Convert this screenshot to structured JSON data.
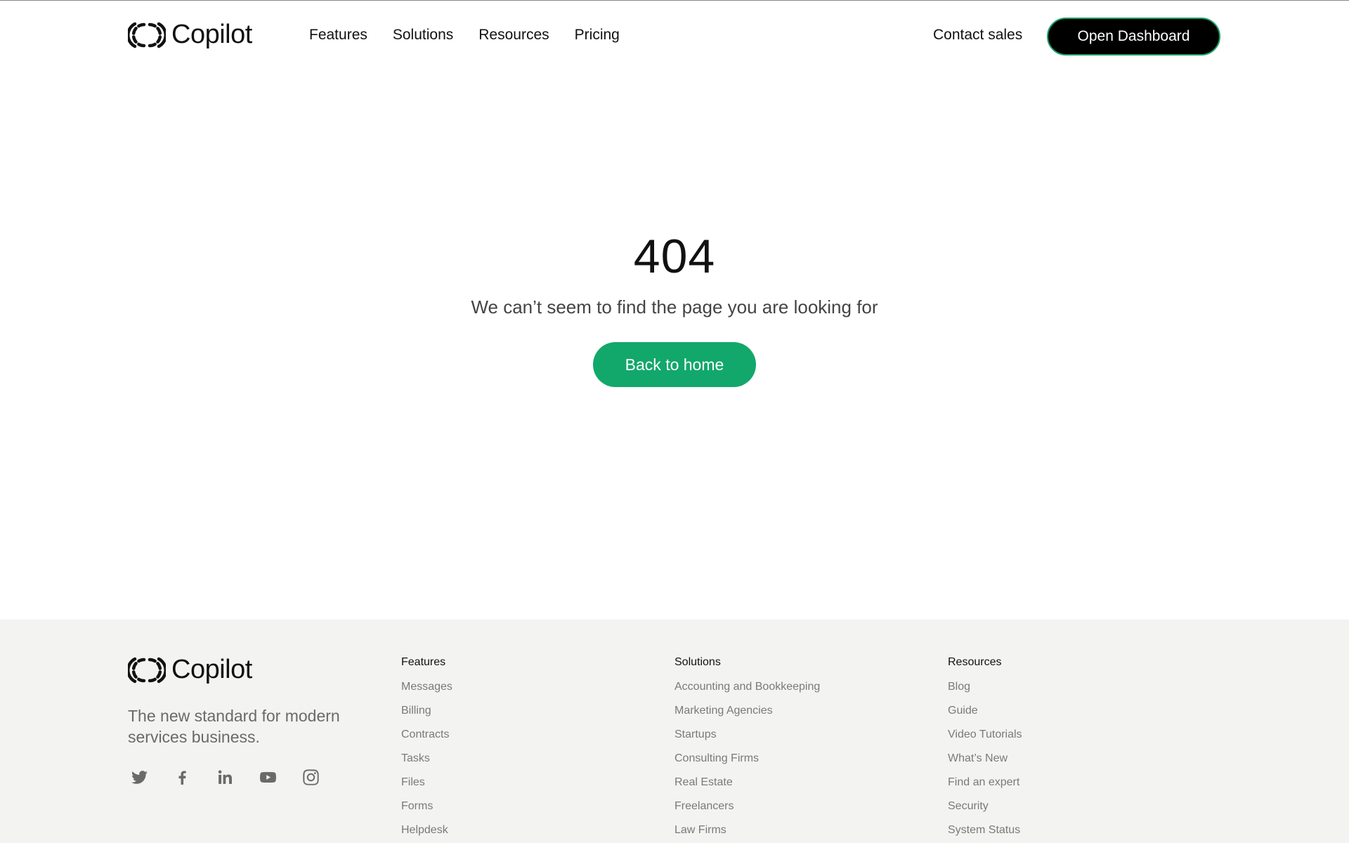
{
  "brand": {
    "name": "Copilot"
  },
  "header": {
    "nav": [
      "Features",
      "Solutions",
      "Resources",
      "Pricing"
    ],
    "contact_sales": "Contact sales",
    "open_dashboard": "Open Dashboard"
  },
  "main": {
    "code": "404",
    "message": "We can’t seem to find the page you are looking for",
    "back_home": "Back to home"
  },
  "footer": {
    "tagline": "The new standard for modern services business.",
    "social_icons": [
      "twitter-icon",
      "facebook-icon",
      "linkedin-icon",
      "youtube-icon",
      "instagram-icon"
    ],
    "columns": {
      "features": {
        "title": "Features",
        "links": [
          "Messages",
          "Billing",
          "Contracts",
          "Tasks",
          "Files",
          "Forms",
          "Helpdesk"
        ]
      },
      "solutions": {
        "title": "Solutions",
        "links": [
          "Accounting and Bookkeeping",
          "Marketing Agencies",
          "Startups",
          "Consulting Firms",
          "Real Estate",
          "Freelancers",
          "Law Firms"
        ]
      },
      "resources": {
        "title": "Resources",
        "links": [
          "Blog",
          "Guide",
          "Video Tutorials",
          "What’s New",
          "Find an expert",
          "Security",
          "System Status"
        ]
      }
    }
  },
  "colors": {
    "accent_green": "#12a86b",
    "dashboard_button": "#000000",
    "footer_bg": "#f3f3f2",
    "muted_text": "#7a7a7a"
  }
}
